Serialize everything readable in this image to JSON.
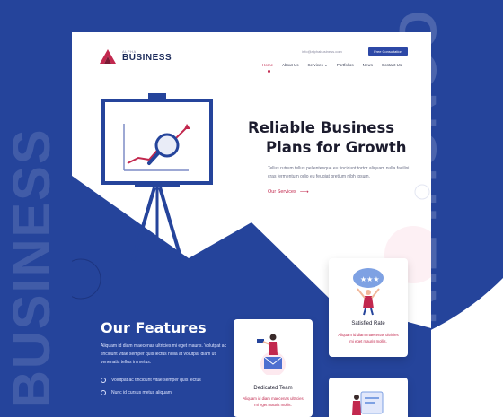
{
  "colors": {
    "brand_blue": "#25449b",
    "accent": "#c2284e",
    "button": "#2d48a6"
  },
  "side_text": {
    "left": "BUSINESS",
    "right": "CONSULTING"
  },
  "logo": {
    "small": "ALPHA",
    "big": "BUSINESS"
  },
  "header": {
    "email": "info@alphabusiness.com",
    "cta": "Free Consultation"
  },
  "nav": [
    {
      "label": "Home",
      "active": true
    },
    {
      "label": "About Us"
    },
    {
      "label": "Services ⌄"
    },
    {
      "label": "Portfolios"
    },
    {
      "label": "News"
    },
    {
      "label": "Contact Us"
    }
  ],
  "hero": {
    "title_line1": "Reliable Business",
    "title_line2": "Plans for Growth",
    "desc": "Tellus rutrum tellus pellentesque eu tincidunt tortor aliquam nulla facilisi cras fermentum odio eu feugiat pretium nibh ipsum.",
    "link": "Our Services",
    "link_icon": "arrow-right-icon"
  },
  "features": {
    "title": "Our Features",
    "desc": "Aliquam id diam maecenas ultricies mi eget mauris. Volutpat ac tincidunt vitae semper quis lectus nulla at volutpat diam ut venenatis tellus in metus.",
    "items": [
      "Volutpat ac tincidunt vitae semper quis lectus",
      "Nunc id cursus metus aliquam"
    ]
  },
  "cards": [
    {
      "title": "Satisfied Rate",
      "desc": "Aliquam id diam maecenas ultricies mi eget mauris mollis."
    },
    {
      "title": "Dedicated Team",
      "desc": "Aliquam id diam maecenas ultricies mi eget mauris mollis."
    },
    {
      "title": "",
      "desc": ""
    }
  ]
}
